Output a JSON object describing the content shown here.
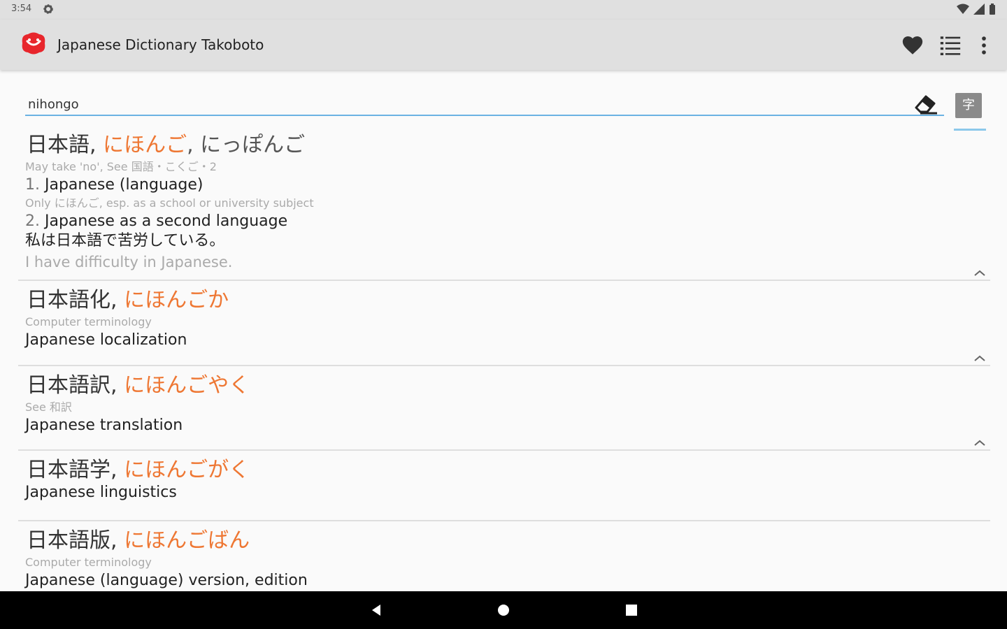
{
  "status": {
    "time": "3:54"
  },
  "app_bar": {
    "title": "Japanese Dictionary Takoboto"
  },
  "search": {
    "value": "nihongo",
    "kanji_button_label": "字"
  },
  "results": [
    {
      "word": "日本語",
      "sep1": ", ",
      "reading": "にほんご",
      "sep2": ", ",
      "alt_reading": "にっぽんご",
      "note1": "May take 'no', See 国語・こくご・2",
      "meaning1_num": "1. ",
      "meaning1": "Japanese (language)",
      "note2": "Only にほんご, esp. as a school or university subject",
      "meaning2_num": "2. ",
      "meaning2": "Japanese as a second language",
      "example_jp": "私は日本語で苦労している。",
      "example_en": "I have difficulty in Japanese."
    },
    {
      "word": "日本語化",
      "sep1": ", ",
      "reading": "にほんごか",
      "note": "Computer terminology",
      "meaning": "Japanese localization"
    },
    {
      "word": "日本語訳",
      "sep1": ", ",
      "reading": "にほんごやく",
      "note": "See 和訳",
      "meaning": "Japanese translation"
    },
    {
      "word": "日本語学",
      "sep1": ", ",
      "reading": "にほんごがく",
      "meaning": "Japanese linguistics"
    },
    {
      "word": "日本語版",
      "sep1": ", ",
      "reading": "にほんごばん",
      "note": "Computer terminology",
      "meaning": "Japanese (language) version, edition"
    }
  ],
  "colors": {
    "kana": "#ee7733",
    "accent": "#6ab2e2",
    "logo": "#e8262c"
  }
}
